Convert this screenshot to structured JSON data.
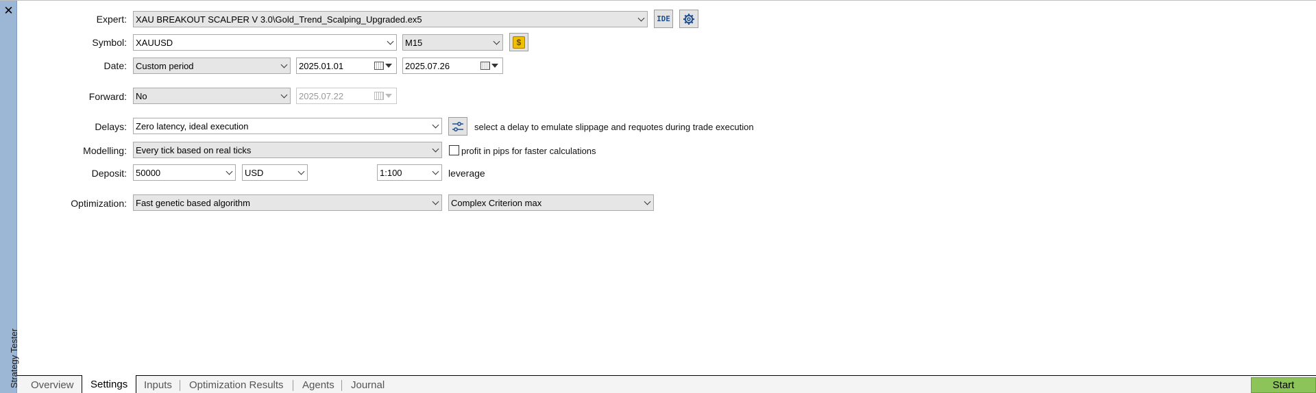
{
  "side": {
    "title": "Strategy Tester",
    "close_icon": "close-icon"
  },
  "labels": {
    "expert": "Expert:",
    "symbol": "Symbol:",
    "date": "Date:",
    "forward": "Forward:",
    "delays": "Delays:",
    "modelling": "Modelling:",
    "deposit": "Deposit:",
    "optimization": "Optimization:"
  },
  "expert": {
    "value": "XAU BREAKOUT SCALPER V 3.0\\Gold_Trend_Scalping_Upgraded.ex5",
    "ide_label": "IDE"
  },
  "symbol": {
    "value": "XAUUSD",
    "timeframe": "M15",
    "coin_label": "$"
  },
  "date": {
    "range": "Custom period",
    "from": "2025.01.01",
    "to": "2025.07.26"
  },
  "forward": {
    "value": "No",
    "date": "2025.07.22"
  },
  "delays": {
    "value": "Zero latency, ideal execution",
    "hint": "select a delay to emulate slippage and requotes during trade execution"
  },
  "modelling": {
    "value": "Every tick based on real ticks",
    "checkbox_label": "profit in pips for faster calculations",
    "checked": false
  },
  "deposit": {
    "amount": "50000",
    "currency": "USD",
    "leverage": "1:100",
    "leverage_label": "leverage"
  },
  "optimization": {
    "algorithm": "Fast genetic based algorithm",
    "criterion": "Complex Criterion max"
  },
  "tabs": [
    {
      "label": "Overview",
      "active": false
    },
    {
      "label": "Settings",
      "active": true
    },
    {
      "label": "Inputs",
      "active": false
    },
    {
      "label": "Optimization Results",
      "active": false
    },
    {
      "label": "Agents",
      "active": false
    },
    {
      "label": "Journal",
      "active": false
    }
  ],
  "start_label": "Start",
  "colors": {
    "side_strip": "#9cb6d6",
    "start_button": "#8dc45a",
    "coin": "#f0c000"
  }
}
